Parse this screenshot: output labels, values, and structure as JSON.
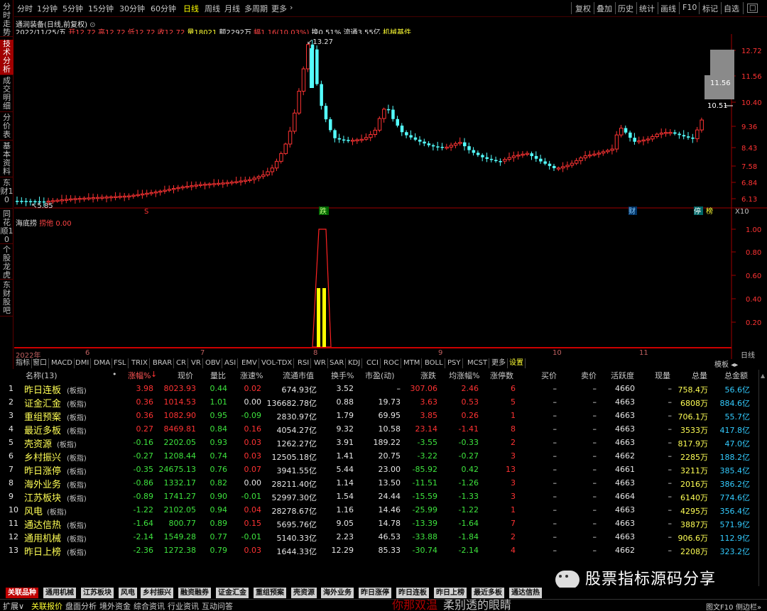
{
  "left_tabs": [
    "分时走势",
    "技术分析",
    "成交明细",
    "分价表",
    "基本资料",
    "东财10",
    "同花顺10",
    "个股龙虎",
    "东财股吧"
  ],
  "toolbar": {
    "periods": [
      "分时",
      "1分钟",
      "5分钟",
      "15分钟",
      "30分钟",
      "60分钟",
      "日线",
      "周线",
      "月线",
      "多周期",
      "更多"
    ],
    "active_period": "日线",
    "right_buttons": [
      "复权",
      "叠加",
      "历史",
      "统计",
      "画线",
      "F10",
      "标记",
      "自选"
    ]
  },
  "stock": {
    "title": "通润装备(日线,前复权)",
    "date": "2022/11/25/五",
    "open_label": "开",
    "open": "12.72",
    "high_label": "高",
    "high": "12.72",
    "low_label": "低",
    "low": "12.72",
    "close_label": "收",
    "close": "12.72",
    "volume_label": "量",
    "volume": "18021",
    "amount_label": "额",
    "amount": "2292万",
    "change_label": "幅",
    "change": "1.16(10.03%)",
    "turnover_label": "换",
    "turnover": "0.51%",
    "float_label": "流通",
    "float_value": "3.55亿",
    "sector": "机械基件"
  },
  "price_axis": [
    "12.72",
    "11.56",
    "10.40",
    "9.36",
    "8.43",
    "7.58",
    "6.84",
    "6.13"
  ],
  "price_marks": {
    "high_label": "13.27",
    "low_label": "5.85",
    "hover_box": "11.56",
    "crosshair_value": "10.51"
  },
  "chart_markers": {
    "s_marker": "S",
    "die": "跌",
    "cai": "财",
    "ting": "停",
    "bang": "榜",
    "x10": "X10"
  },
  "indicator": {
    "name": "海底捞",
    "line_label": "捞他",
    "line_value": "0.00",
    "axis": [
      "1.00",
      "0.80",
      "0.60",
      "0.40",
      "0.20"
    ]
  },
  "time_axis": {
    "labels": [
      "2022年",
      "6",
      "7",
      "8",
      "9",
      "10",
      "11"
    ],
    "right_label": "日线"
  },
  "indicator_tabs": [
    "指标",
    "窗口",
    "MACD",
    "DMI",
    "DMA",
    "FSL",
    "TRIX",
    "BRAR",
    "CR",
    "VR",
    "OBV",
    "ASI",
    "EMV",
    "VOL-TDX",
    "RSI",
    "WR",
    "SAR",
    "KDJ",
    "CCI",
    "ROC",
    "MTM",
    "BOLL",
    "PSY",
    "MCST",
    "更多",
    "设置"
  ],
  "indicator_tabs_right": "模板",
  "table": {
    "headers": [
      "名称(13)",
      "•",
      "涨幅%",
      "现价",
      "量比",
      "涨速%",
      "流通市值",
      "换手%",
      "市盈(动)",
      "涨跌",
      "均涨幅%",
      "涨停数",
      "买价",
      "卖价",
      "活跃度",
      "现量",
      "总量",
      "总金额"
    ],
    "tag": "(板指)",
    "rows": [
      {
        "no": "1",
        "name": "昨日连板",
        "chg": "3.98",
        "price": "8023.93",
        "vr": "0.44",
        "spd": "0.02",
        "mcap": "674.93亿",
        "turn": "3.52",
        "pe": "–",
        "diff": "307.06",
        "avg": "2.46",
        "limit": "6",
        "bid": "–",
        "ask": "–",
        "act": "4660",
        "cur": "–",
        "vol": "758.4万",
        "amt": "56.6亿",
        "c": "r",
        "sc": "r"
      },
      {
        "no": "2",
        "name": "证金汇金",
        "chg": "0.36",
        "price": "1014.53",
        "vr": "1.01",
        "spd": "0.00",
        "mcap": "136682.78亿",
        "turn": "0.88",
        "pe": "19.73",
        "diff": "3.63",
        "avg": "0.53",
        "limit": "5",
        "bid": "–",
        "ask": "–",
        "act": "4663",
        "cur": "–",
        "vol": "6808万",
        "amt": "884.6亿",
        "c": "r",
        "sc": "w"
      },
      {
        "no": "3",
        "name": "重组预案",
        "chg": "0.36",
        "price": "1082.90",
        "vr": "0.95",
        "spd": "-0.09",
        "mcap": "2830.97亿",
        "turn": "1.79",
        "pe": "69.95",
        "diff": "3.85",
        "avg": "0.26",
        "limit": "1",
        "bid": "–",
        "ask": "–",
        "act": "4663",
        "cur": "–",
        "vol": "706.1万",
        "amt": "55.7亿",
        "c": "r",
        "sc": "g"
      },
      {
        "no": "4",
        "name": "最近多板",
        "chg": "0.27",
        "price": "8469.81",
        "vr": "0.84",
        "spd": "0.16",
        "mcap": "4054.27亿",
        "turn": "9.32",
        "pe": "10.58",
        "diff": "23.14",
        "avg": "-1.41",
        "limit": "8",
        "bid": "–",
        "ask": "–",
        "act": "4663",
        "cur": "–",
        "vol": "3533万",
        "amt": "417.8亿",
        "c": "r",
        "sc": "r"
      },
      {
        "no": "5",
        "name": "壳资源",
        "chg": "-0.16",
        "price": "2202.05",
        "vr": "0.93",
        "spd": "0.03",
        "mcap": "1262.27亿",
        "turn": "3.91",
        "pe": "189.22",
        "diff": "-3.55",
        "avg": "-0.33",
        "limit": "2",
        "bid": "–",
        "ask": "–",
        "act": "4663",
        "cur": "–",
        "vol": "817.9万",
        "amt": "47.0亿",
        "c": "g",
        "sc": "r"
      },
      {
        "no": "6",
        "name": "乡村振兴",
        "chg": "-0.27",
        "price": "1208.44",
        "vr": "0.74",
        "spd": "0.03",
        "mcap": "12505.18亿",
        "turn": "1.41",
        "pe": "20.75",
        "diff": "-3.22",
        "avg": "-0.27",
        "limit": "3",
        "bid": "–",
        "ask": "–",
        "act": "4662",
        "cur": "–",
        "vol": "2285万",
        "amt": "188.2亿",
        "c": "g",
        "sc": "r"
      },
      {
        "no": "7",
        "name": "昨日涨停",
        "chg": "-0.35",
        "price": "24675.13",
        "vr": "0.76",
        "spd": "0.07",
        "mcap": "3941.55亿",
        "turn": "5.44",
        "pe": "23.00",
        "diff": "-85.92",
        "avg": "0.42",
        "limit": "13",
        "bid": "–",
        "ask": "–",
        "act": "4661",
        "cur": "–",
        "vol": "3211万",
        "amt": "385.4亿",
        "c": "g",
        "sc": "r"
      },
      {
        "no": "8",
        "name": "海外业务",
        "chg": "-0.86",
        "price": "1332.17",
        "vr": "0.82",
        "spd": "0.00",
        "mcap": "28211.40亿",
        "turn": "1.14",
        "pe": "13.50",
        "diff": "-11.51",
        "avg": "-1.26",
        "limit": "3",
        "bid": "–",
        "ask": "–",
        "act": "4663",
        "cur": "–",
        "vol": "2016万",
        "amt": "386.2亿",
        "c": "g",
        "sc": "w"
      },
      {
        "no": "9",
        "name": "江苏板块",
        "chg": "-0.89",
        "price": "1741.27",
        "vr": "0.90",
        "spd": "-0.01",
        "mcap": "52997.30亿",
        "turn": "1.54",
        "pe": "24.44",
        "diff": "-15.59",
        "avg": "-1.33",
        "limit": "3",
        "bid": "–",
        "ask": "–",
        "act": "4664",
        "cur": "–",
        "vol": "6140万",
        "amt": "774.6亿",
        "c": "g",
        "sc": "g"
      },
      {
        "no": "10",
        "name": "风电",
        "chg": "-1.22",
        "price": "2102.05",
        "vr": "0.94",
        "spd": "0.04",
        "mcap": "28278.67亿",
        "turn": "1.16",
        "pe": "14.46",
        "diff": "-25.99",
        "avg": "-1.22",
        "limit": "1",
        "bid": "–",
        "ask": "–",
        "act": "4663",
        "cur": "–",
        "vol": "4295万",
        "amt": "356.4亿",
        "c": "g",
        "sc": "r"
      },
      {
        "no": "11",
        "name": "通达信热",
        "chg": "-1.64",
        "price": "800.77",
        "vr": "0.89",
        "spd": "0.15",
        "mcap": "5695.76亿",
        "turn": "9.05",
        "pe": "14.78",
        "diff": "-13.39",
        "avg": "-1.64",
        "limit": "7",
        "bid": "–",
        "ask": "–",
        "act": "4663",
        "cur": "–",
        "vol": "3887万",
        "amt": "571.9亿",
        "c": "g",
        "sc": "r"
      },
      {
        "no": "12",
        "name": "通用机械",
        "chg": "-2.14",
        "price": "1549.28",
        "vr": "0.77",
        "spd": "-0.01",
        "mcap": "5140.33亿",
        "turn": "2.23",
        "pe": "46.53",
        "diff": "-33.88",
        "avg": "-1.84",
        "limit": "2",
        "bid": "–",
        "ask": "–",
        "act": "4663",
        "cur": "–",
        "vol": "906.6万",
        "amt": "112.9亿",
        "c": "g",
        "sc": "g"
      },
      {
        "no": "13",
        "name": "昨日上榜",
        "chg": "-2.36",
        "price": "1272.38",
        "vr": "0.79",
        "spd": "0.03",
        "mcap": "1644.33亿",
        "turn": "12.29",
        "pe": "85.33",
        "diff": "-30.74",
        "avg": "-2.14",
        "limit": "4",
        "bid": "–",
        "ask": "–",
        "act": "4662",
        "cur": "–",
        "vol": "2208万",
        "amt": "323.2亿",
        "c": "g",
        "sc": "r"
      }
    ]
  },
  "watermark": "股票指标源码分享",
  "bottom_tabs": [
    "关联品种",
    "通用机械",
    "江苏板块",
    "风电",
    "乡村振兴",
    "融资融券",
    "证金汇金",
    "重组预案",
    "壳资源",
    "海外业务",
    "昨日涨停",
    "昨日连板",
    "昨日上榜",
    "最近多板",
    "通达信热"
  ],
  "status_bar": {
    "items": [
      "扩展∨",
      "关联报价",
      "盘面分析",
      "境外资金",
      "综合资讯",
      "行业资讯",
      "互动问答"
    ],
    "overlay_red": "你那双温",
    "overlay_white": "柔别透的眼睛",
    "right": [
      "图文F10",
      "侧边栏»"
    ]
  },
  "colors": {
    "up": "#ff3333",
    "down": "#54ffff",
    "name": "#ffff55",
    "frame": "#a00000"
  }
}
